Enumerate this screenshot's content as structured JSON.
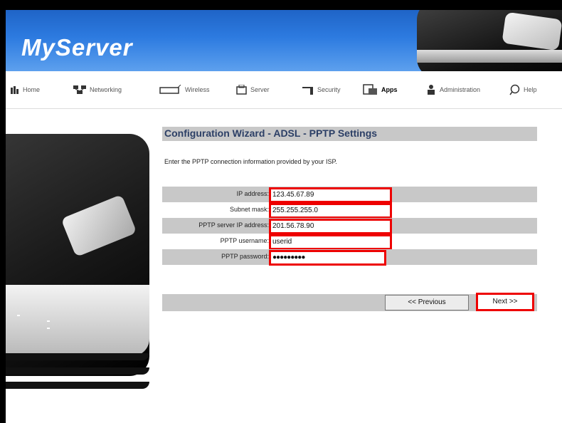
{
  "app": {
    "title": "MyServer"
  },
  "nav": {
    "items": [
      {
        "label": "Home",
        "icon": "home-icon"
      },
      {
        "label": "Networking",
        "icon": "networking-icon"
      },
      {
        "label": "Wireless",
        "icon": "wireless-icon"
      },
      {
        "label": "Server",
        "icon": "server-icon"
      },
      {
        "label": "Security",
        "icon": "security-icon"
      },
      {
        "label": "Apps",
        "icon": "apps-icon"
      },
      {
        "label": "Administration",
        "icon": "administration-icon"
      },
      {
        "label": "Help",
        "icon": "help-icon"
      }
    ]
  },
  "wizard": {
    "title": "Configuration Wizard - ADSL - PPTP Settings",
    "intro": "Enter the PPTP connection information provided by your ISP.",
    "fields": {
      "ip_address": {
        "label": "IP address:",
        "value": "123.45.67.89"
      },
      "subnet_mask": {
        "label": "Subnet mask:",
        "value": "255.255.255.0"
      },
      "server_ip": {
        "label": "PPTP server IP address:",
        "value": "201.56.78.90"
      },
      "username": {
        "label": "PPTP username:",
        "value": "userid"
      },
      "password": {
        "label": "PPTP password:",
        "value": "●●●●●●●●●"
      }
    },
    "buttons": {
      "previous": "<< Previous",
      "next": "Next >>"
    }
  },
  "colors": {
    "accent_red": "#e00000",
    "title_text": "#2c3f66",
    "row_shade": "#c8c8c8",
    "banner_blue": "#2d7be0"
  }
}
